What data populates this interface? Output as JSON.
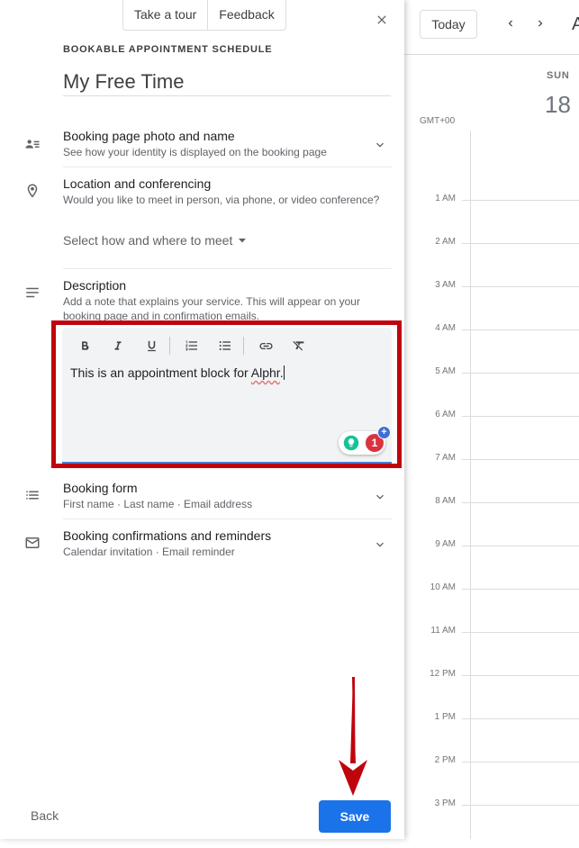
{
  "calendar": {
    "today_label": "Today",
    "month_partial": "A",
    "day_name": "SUN",
    "day_number": "18",
    "timezone": "GMT+00",
    "hours": [
      "1 AM",
      "2 AM",
      "3 AM",
      "4 AM",
      "5 AM",
      "6 AM",
      "7 AM",
      "8 AM",
      "9 AM",
      "10 AM",
      "11 AM",
      "12 PM",
      "1 PM",
      "2 PM",
      "3 PM"
    ]
  },
  "panel": {
    "take_tour": "Take a tour",
    "feedback": "Feedback",
    "overline": "BOOKABLE APPOINTMENT SCHEDULE",
    "title": "My Free Time",
    "sections": {
      "booking_page": {
        "title": "Booking page photo and name",
        "subtitle": "See how your identity is displayed on the booking page"
      },
      "location": {
        "title": "Location and conferencing",
        "subtitle": "Would you like to meet in person, via phone, or video conference?",
        "select_label": "Select how and where to meet"
      },
      "description": {
        "title": "Description",
        "subtitle": "Add a note that explains your service. This will appear on your booking page and in confirmation emails.",
        "text_before": "This is an appointment block for ",
        "text_misspelled": "Alphr",
        "text_after": ".",
        "grammarly_count": "1",
        "grammarly_plus": "+"
      },
      "booking_form": {
        "title": "Booking form",
        "subtitle": "First name · Last name · Email address"
      },
      "confirmations": {
        "title": "Booking confirmations and reminders",
        "subtitle": "Calendar invitation · Email reminder"
      }
    },
    "back_label": "Back",
    "save_label": "Save"
  },
  "colors": {
    "primary": "#1a73e8",
    "highlight": "#c0040d",
    "editor_bg": "#f1f3f4",
    "grammarly_green": "#15c39a",
    "grammarly_red": "#d9333f"
  }
}
